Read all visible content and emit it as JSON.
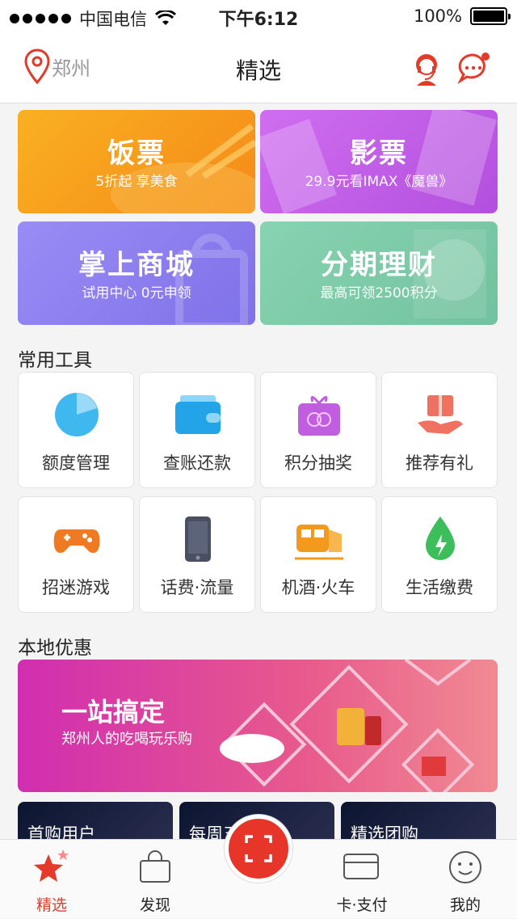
{
  "status_bar": {
    "carrier": "中国电信",
    "time": "下午6:12",
    "battery": "100%"
  },
  "nav": {
    "location": "郑州",
    "title": "精选"
  },
  "banners": [
    {
      "title": "饭票",
      "subtitle": "5折起 享美食",
      "color": "#f7a21b"
    },
    {
      "title": "影票",
      "subtitle": "29.9元看IMAX《魔兽》",
      "color": "#c35de6"
    },
    {
      "title": "掌上商城",
      "subtitle": "试用中心  0元申领",
      "color": "#8c7ff0"
    },
    {
      "title": "分期理财",
      "subtitle": "最高可领2500积分",
      "color": "#7dc9a6"
    }
  ],
  "tools": {
    "heading": "常用工具",
    "items": [
      {
        "label": "额度管理",
        "icon": "pie-chart-icon"
      },
      {
        "label": "查账还款",
        "icon": "wallet-icon"
      },
      {
        "label": "积分抽奖",
        "icon": "gift-box-icon"
      },
      {
        "label": "推荐有礼",
        "icon": "gift-hand-icon"
      },
      {
        "label": "招迷游戏",
        "icon": "gamepad-icon"
      },
      {
        "label": "话费·流量",
        "icon": "phone-icon"
      },
      {
        "label": "机酒·火车",
        "icon": "train-icon"
      },
      {
        "label": "生活缴费",
        "icon": "water-drop-icon"
      }
    ]
  },
  "local": {
    "heading": "本地优惠",
    "promo_title": "一站搞定",
    "promo_subtitle": "郑州人的吃喝玩乐购",
    "cards": [
      "首购用户",
      "每周五",
      "精选团购"
    ]
  },
  "tabbar": {
    "items": [
      "精选",
      "发现",
      "卡·支付",
      "我的"
    ]
  },
  "colors": {
    "accent": "#e53a2a"
  }
}
